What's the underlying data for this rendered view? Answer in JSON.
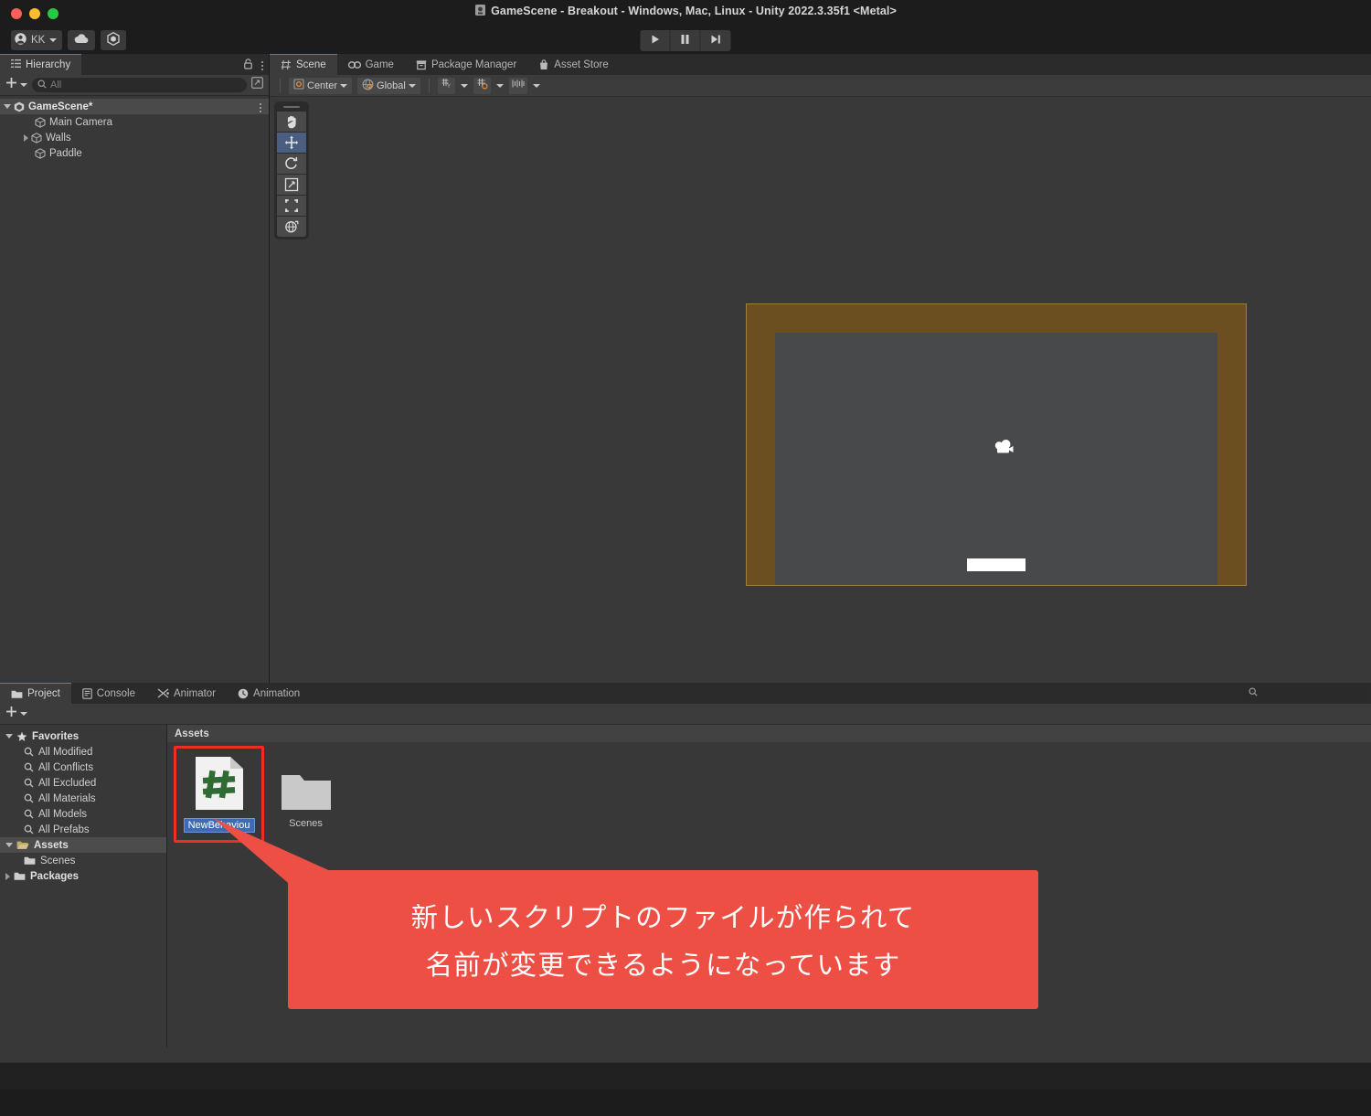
{
  "window": {
    "title": "GameScene - Breakout - Windows, Mac, Linux - Unity 2022.3.35f1 <Metal>",
    "traffic_lights": [
      "close",
      "minimize",
      "maximize"
    ]
  },
  "toolbar": {
    "account_label": "KK",
    "account_icon": "person-icon",
    "cloud_icon": "cloud-icon",
    "services_icon": "unity-services-icon",
    "play_icon": "play-icon",
    "pause_icon": "pause-icon",
    "step_icon": "step-icon"
  },
  "hierarchy": {
    "tab_label": "Hierarchy",
    "tab_icon": "hierarchy-icon",
    "lock_icon": "lock-icon",
    "menu_icon": "vertical-dots-icon",
    "add_label": "+",
    "search_placeholder": "All",
    "search_icon": "search-icon",
    "expand_icon": "expand-icon",
    "nodes": [
      {
        "label": "GameScene*",
        "depth": 0,
        "expander": "open",
        "icon": "unity-scene-icon",
        "selected": true
      },
      {
        "label": "Main Camera",
        "depth": 1,
        "expander": "none",
        "icon": "gameobject-cube-icon",
        "selected": false
      },
      {
        "label": "Walls",
        "depth": 1,
        "expander": "closed",
        "icon": "gameobject-cube-icon",
        "selected": false
      },
      {
        "label": "Paddle",
        "depth": 1,
        "expander": "none",
        "icon": "gameobject-cube-icon",
        "selected": false
      }
    ]
  },
  "scene_panel": {
    "tabs": [
      {
        "label": "Scene",
        "icon": "scene-grid-icon",
        "active": true
      },
      {
        "label": "Game",
        "icon": "game-controller-icon",
        "active": false
      },
      {
        "label": "Package Manager",
        "icon": "package-icon",
        "active": false
      },
      {
        "label": "Asset Store",
        "icon": "store-bag-icon",
        "active": false
      }
    ],
    "pivot_label": "Center",
    "pivot_icon": "pivot-center-icon",
    "handle_label": "Global",
    "handle_icon": "globe-icon",
    "grid_icons": [
      "grid-axis-icon",
      "grid-snap-icon",
      "snap-increment-icon"
    ],
    "tools": [
      {
        "name": "hand-tool",
        "selected": false
      },
      {
        "name": "move-tool",
        "selected": true
      },
      {
        "name": "rotate-tool",
        "selected": false
      },
      {
        "name": "scale-tool",
        "selected": false
      },
      {
        "name": "rect-tool",
        "selected": false
      },
      {
        "name": "transform-tool",
        "selected": false
      }
    ],
    "colors": {
      "wall": "#6b4f20",
      "wall_outline": "#a08036",
      "play_area": "#48494b",
      "paddle": "#ffffff",
      "viewport_bg": "#393939"
    },
    "objects": [
      {
        "name": "walls-frame",
        "label": "Walls"
      },
      {
        "name": "camera-gizmo",
        "label": "Main Camera"
      },
      {
        "name": "paddle-object",
        "label": "Paddle"
      }
    ]
  },
  "project_panel": {
    "tabs": [
      {
        "label": "Project",
        "icon": "folder-icon",
        "active": true
      },
      {
        "label": "Console",
        "icon": "console-icon",
        "active": false
      },
      {
        "label": "Animator",
        "icon": "animator-icon",
        "active": false
      },
      {
        "label": "Animation",
        "icon": "clock-icon",
        "active": false
      }
    ],
    "add_label": "+",
    "search_value": "",
    "search_icon": "search-icon",
    "tree": [
      {
        "label": "Favorites",
        "type": "header",
        "expander": "open",
        "icon": "star-icon"
      },
      {
        "label": "All Modified",
        "type": "item",
        "expander": "none",
        "icon": "search-icon"
      },
      {
        "label": "All Conflicts",
        "type": "item",
        "expander": "none",
        "icon": "search-icon"
      },
      {
        "label": "All Excluded",
        "type": "item",
        "expander": "none",
        "icon": "search-icon"
      },
      {
        "label": "All Materials",
        "type": "item",
        "expander": "none",
        "icon": "search-icon"
      },
      {
        "label": "All Models",
        "type": "item",
        "expander": "none",
        "icon": "search-icon"
      },
      {
        "label": "All Prefabs",
        "type": "item",
        "expander": "none",
        "icon": "search-icon"
      },
      {
        "label": "Assets",
        "type": "header",
        "expander": "open",
        "icon": "folder-open-icon",
        "selected": true
      },
      {
        "label": "Scenes",
        "type": "item",
        "expander": "none",
        "icon": "folder-icon"
      },
      {
        "label": "Packages",
        "type": "header",
        "expander": "closed",
        "icon": "folder-icon"
      }
    ],
    "breadcrumb": "Assets",
    "assets": [
      {
        "label": "NewBehaviou",
        "icon": "csharp-script-icon",
        "editing": true,
        "highlighted": true
      },
      {
        "label": "Scenes",
        "icon": "folder-icon",
        "editing": false,
        "highlighted": false
      }
    ]
  },
  "callout": {
    "line1": "新しいスクリプトのファイルが作られて",
    "line2": "名前が変更できるようになっています",
    "color": "#ee4f45",
    "text_color": "#ffffff"
  }
}
